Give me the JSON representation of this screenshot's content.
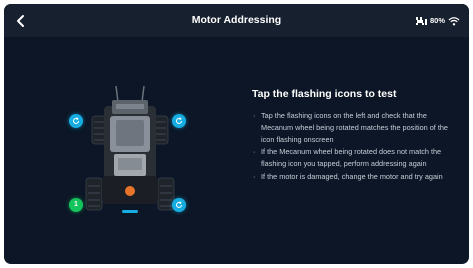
{
  "header": {
    "title": "Motor Addressing",
    "battery_text": "80%",
    "icons": [
      "back-chevron-icon",
      "robot-battery-icon",
      "wifi-icon"
    ]
  },
  "hotspots": [
    {
      "position": "front-left",
      "state": "flashing",
      "icon": "refresh-icon"
    },
    {
      "position": "front-right",
      "state": "flashing",
      "icon": "refresh-icon"
    },
    {
      "position": "rear-left",
      "state": "addressed",
      "label": "1"
    },
    {
      "position": "rear-right",
      "state": "flashing",
      "icon": "refresh-icon"
    }
  ],
  "instructions": {
    "heading": "Tap the flashing icons to test",
    "bullets": [
      "Tap the flashing icons on the left and check that the Mecanum wheel being rotated matches the position of the icon flashing onscreen",
      "If the Mecanum wheel being rotated does not match the flashing icon you tapped, perform addressing again",
      "If the motor is damaged, change the motor and try again"
    ]
  },
  "colors": {
    "background": "#0c1626",
    "topbar": "#17202e",
    "accent_blue": "#16aee2",
    "accent_green": "#12c45b",
    "blaster_orange": "#e8742a"
  }
}
